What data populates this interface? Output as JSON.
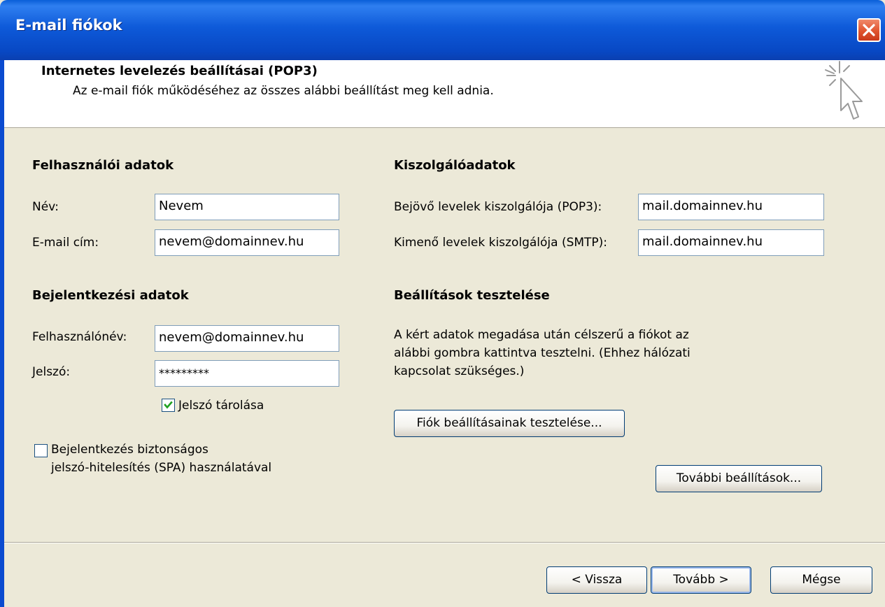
{
  "window": {
    "title": "E-mail fiókok"
  },
  "header": {
    "title": "Internetes levelezés beállításai (POP3)",
    "subtitle": "Az e-mail fiók működéséhez az összes alábbi beállítást meg kell adnia."
  },
  "user_info": {
    "section_title": "Felhasználói adatok",
    "name_label": "Név:",
    "name_value": "Nevem",
    "email_label": "E-mail cím:",
    "email_value": "nevem@domainnev.hu"
  },
  "server_info": {
    "section_title": "Kiszolgálóadatok",
    "incoming_label": "Bejövő levelek kiszolgálója (POP3):",
    "incoming_value": "mail.domainnev.hu",
    "outgoing_label": "Kimenő levelek kiszolgálója (SMTP):",
    "outgoing_value": "mail.domainnev.hu"
  },
  "login_info": {
    "section_title": "Bejelentkezési adatok",
    "username_label": "Felhasználónév:",
    "username_value": "nevem@domainnev.hu",
    "password_label": "Jelszó:",
    "password_value": "*********",
    "remember_label": "Jelszó tárolása",
    "remember_checked": true,
    "spa_label_line1": "Bejelentkezés biztonságos",
    "spa_label_line2": "jelszó-hitelesítés (SPA) használatával",
    "spa_checked": false
  },
  "test_settings": {
    "section_title": "Beállítások tesztelése",
    "description_line1": "A kért adatok megadása után célszerű a fiókot az",
    "description_line2": "alábbi gombra kattintva tesztelni. (Ehhez hálózati",
    "description_line3": "kapcsolat szükséges.)",
    "test_button": "Fiók beállításainak tesztelése..."
  },
  "more_settings_button": "További beállítások...",
  "footer": {
    "back_button": "< Vissza",
    "next_button": "Tovább >",
    "cancel_button": "Mégse"
  },
  "colors": {
    "titlebar": "#0a5fd8",
    "dialog_bg": "#ece9d8",
    "close_button": "#e0542e",
    "checkmark": "#21a121"
  }
}
